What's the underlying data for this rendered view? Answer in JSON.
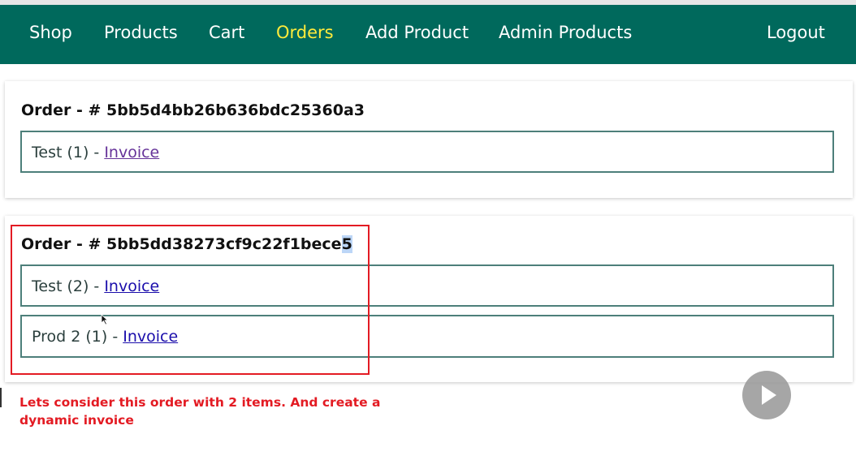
{
  "nav": {
    "items": [
      {
        "label": "Shop",
        "active": false
      },
      {
        "label": "Products",
        "active": false
      },
      {
        "label": "Cart",
        "active": false
      },
      {
        "label": "Orders",
        "active": true
      },
      {
        "label": "Add Product",
        "active": false
      },
      {
        "label": "Admin Products",
        "active": false
      }
    ],
    "logout": "Logout",
    "bg_color": "#00695c",
    "active_color": "#ffeb3b"
  },
  "orders": [
    {
      "title_prefix": "Order - # ",
      "id_main": "5bb5d4bb26b636bdc25360a3",
      "items": [
        {
          "text": "Test (1) - ",
          "link": "Invoice",
          "visited": true
        }
      ]
    },
    {
      "title_prefix": "Order - # ",
      "id_main": "5bb5dd38273cf9c22f1bece",
      "id_highlight": "5",
      "items": [
        {
          "text": "Test (2) - ",
          "link": "Invoice",
          "visited": false
        },
        {
          "text": "Prod 2 (1) - ",
          "link": "Invoice",
          "visited": false
        }
      ]
    }
  ],
  "annotation": {
    "text": "Lets consider this order with 2 items. And create a dynamic invoice",
    "color": "#e31b23"
  },
  "player": {
    "icon": "play-icon"
  }
}
